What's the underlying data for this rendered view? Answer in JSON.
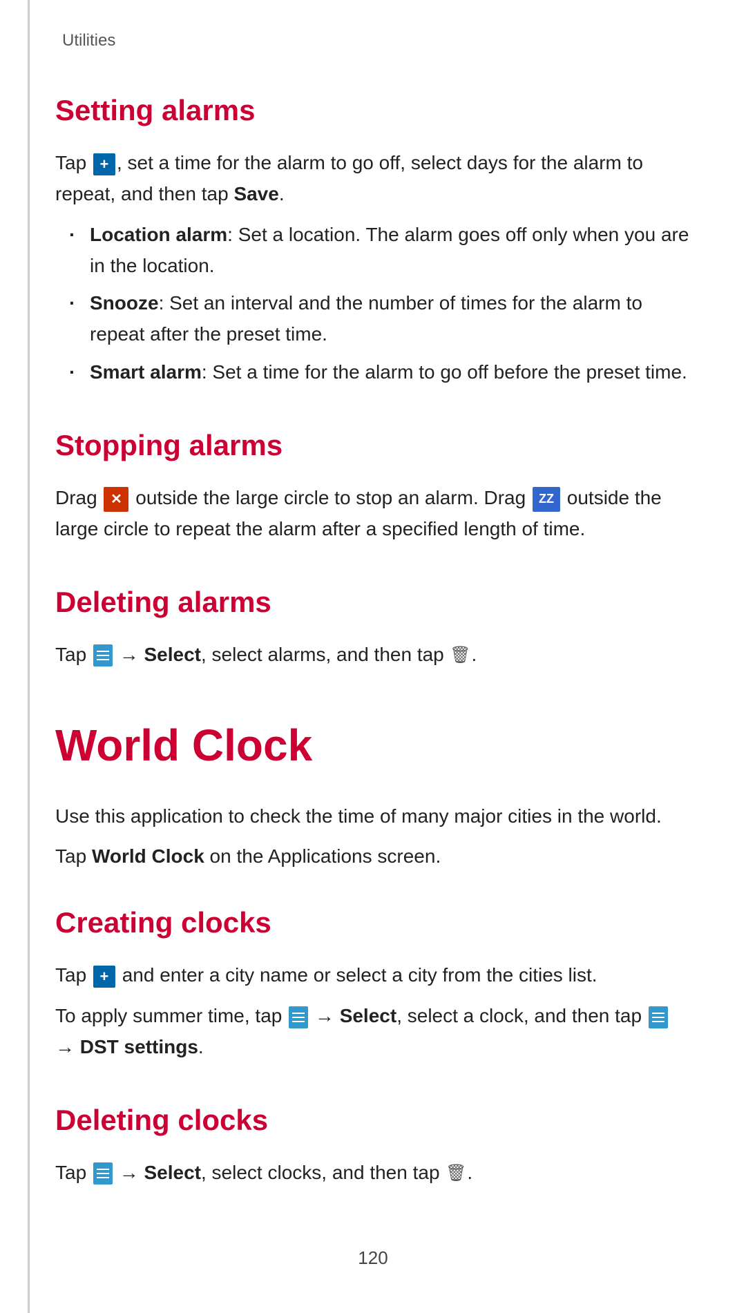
{
  "page": {
    "breadcrumb": "Utilities",
    "page_number": "120"
  },
  "setting_alarms": {
    "heading": "Setting alarms",
    "paragraph1_prefix": "Tap",
    "paragraph1_suffix": ", set a time for the alarm to go off, select days for the alarm to repeat, and then tap",
    "paragraph1_bold": "Save",
    "paragraph1_end": ".",
    "bullet_items": [
      {
        "label": "Location alarm",
        "label_suffix": ": Set a location. The alarm goes off only when you are in the location."
      },
      {
        "label": "Snooze",
        "label_suffix": ": Set an interval and the number of times for the alarm to repeat after the preset time."
      },
      {
        "label": "Smart alarm",
        "label_suffix": ": Set a time for the alarm to go off before the preset time."
      }
    ]
  },
  "stopping_alarms": {
    "heading": "Stopping alarms",
    "paragraph": "outside the large circle to stop an alarm. Drag",
    "paragraph2": "outside the large circle to repeat the alarm after a specified length of time."
  },
  "deleting_alarms": {
    "heading": "Deleting alarms",
    "paragraph_prefix": "Tap",
    "paragraph_middle": "Select",
    "paragraph_suffix": ", select alarms, and then tap"
  },
  "world_clock": {
    "heading": "World Clock",
    "paragraph1": "Use this application to check the time of many major cities in the world.",
    "paragraph2_prefix": "Tap",
    "paragraph2_bold": "World Clock",
    "paragraph2_suffix": "on the Applications screen."
  },
  "creating_clocks": {
    "heading": "Creating clocks",
    "paragraph1_prefix": "Tap",
    "paragraph1_suffix": "and enter a city name or select a city from the cities list.",
    "paragraph2_prefix": "To apply summer time, tap",
    "paragraph2_select": "Select",
    "paragraph2_middle": ", select a clock, and then tap",
    "paragraph2_dst": "DST settings",
    "paragraph2_end": "."
  },
  "deleting_clocks": {
    "heading": "Deleting clocks",
    "paragraph_prefix": "Tap",
    "paragraph_select": "Select",
    "paragraph_suffix": ", select clocks, and then tap"
  }
}
